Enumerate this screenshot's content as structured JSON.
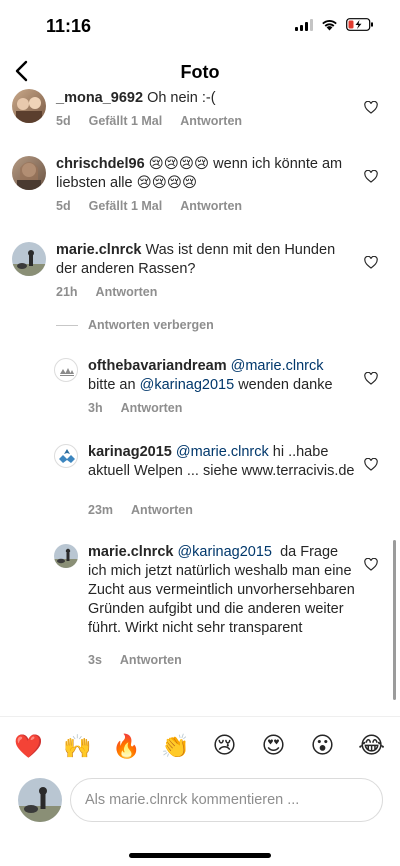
{
  "status": {
    "time": "11:16"
  },
  "nav": {
    "title": "Foto"
  },
  "comments": [
    {
      "user": "_mona_9692",
      "text": "Oh nein :-(",
      "time": "5d",
      "likes": "Gefällt 1 Mal",
      "reply": "Antworten"
    },
    {
      "user": "chrischdel96",
      "text": "😢😢😢😢 wenn ich könnte am liebsten alle 😢😢😢😢",
      "time": "5d",
      "likes": "Gefällt 1 Mal",
      "reply": "Antworten"
    },
    {
      "user": "marie.clnrck",
      "text": "Was ist denn mit den Hunden der anderen Rassen?",
      "time": "21h",
      "reply": "Antworten"
    }
  ],
  "hide_replies": "Antworten verbergen",
  "replies": [
    {
      "user": "ofthebavariandream",
      "mention": "@marie.clnrck",
      "text_before": "bitte an",
      "mention2": "@karinag2015",
      "text_after": "wenden danke",
      "time": "3h",
      "reply": "Antworten"
    },
    {
      "user": "karinag2015",
      "mention": "@marie.clnrck",
      "text": "hi ..habe aktuell Welpen ... siehe www.terracivis.de",
      "time": "23m",
      "reply": "Antworten"
    },
    {
      "user": "marie.clnrck",
      "mention": "@karinag2015",
      "text": "da Frage ich mich jetzt natürlich weshalb man eine Zucht aus vermeintlich unvorhersehbaren Gründen aufgibt und die anderen weiter führt. Wirkt nicht sehr transparent",
      "time": "3s",
      "reply": "Antworten"
    }
  ],
  "emoji_bar": [
    "❤️",
    "🙌",
    "🔥",
    "👏",
    "😢",
    "😍",
    "😮",
    "😂"
  ],
  "compose": {
    "placeholder": "Als marie.clnrck kommentieren ..."
  },
  "colors": {
    "mention": "#00376b",
    "meta": "#8e8e8e",
    "border": "#dbdbdb"
  }
}
